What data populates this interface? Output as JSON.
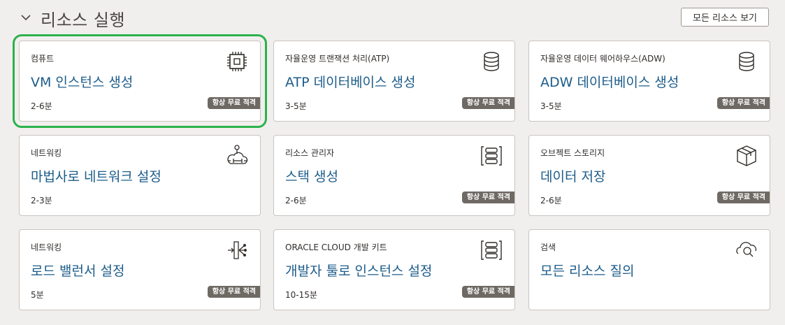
{
  "header": {
    "title": "리소스 실행",
    "view_all_label": "모든 리소스 보기"
  },
  "badge_label": "항상 무료 적격",
  "cards": [
    {
      "category": "컴퓨트",
      "title": "VM 인스턴스 생성",
      "time": "2-6분",
      "badge": true,
      "icon": "chip-icon",
      "selected": true
    },
    {
      "category": "자율운영 트랜잭션 처리(ATP)",
      "title": "ATP 데이터베이스 생성",
      "time": "3-5분",
      "badge": true,
      "icon": "database-icon"
    },
    {
      "category": "자율운영 데이터 웨어하우스(ADW)",
      "title": "ADW 데이터베이스 생성",
      "time": "3-5분",
      "badge": true,
      "icon": "database-icon"
    },
    {
      "category": "네트워킹",
      "title": "마법사로 네트워크 설정",
      "time": "2-3분",
      "badge": false,
      "icon": "network-cloud-icon"
    },
    {
      "category": "리소스 관리자",
      "title": "스택 생성",
      "time": "2-6분",
      "badge": true,
      "icon": "stack-icon"
    },
    {
      "category": "오브젝트 스토리지",
      "title": "데이터 저장",
      "time": "2-6분",
      "badge": true,
      "icon": "box-icon"
    },
    {
      "category": "네트워킹",
      "title": "로드 밸런서 설정",
      "time": "5분",
      "badge": true,
      "icon": "load-balancer-icon"
    },
    {
      "category": "ORACLE CLOUD 개발 키트",
      "title": "개발자 툴로 인스턴스 설정",
      "time": "10-15분",
      "badge": true,
      "icon": "stack-icon"
    },
    {
      "category": "검색",
      "title": "모든 리소스 질의",
      "time": "",
      "badge": false,
      "icon": "search-cloud-icon"
    }
  ]
}
